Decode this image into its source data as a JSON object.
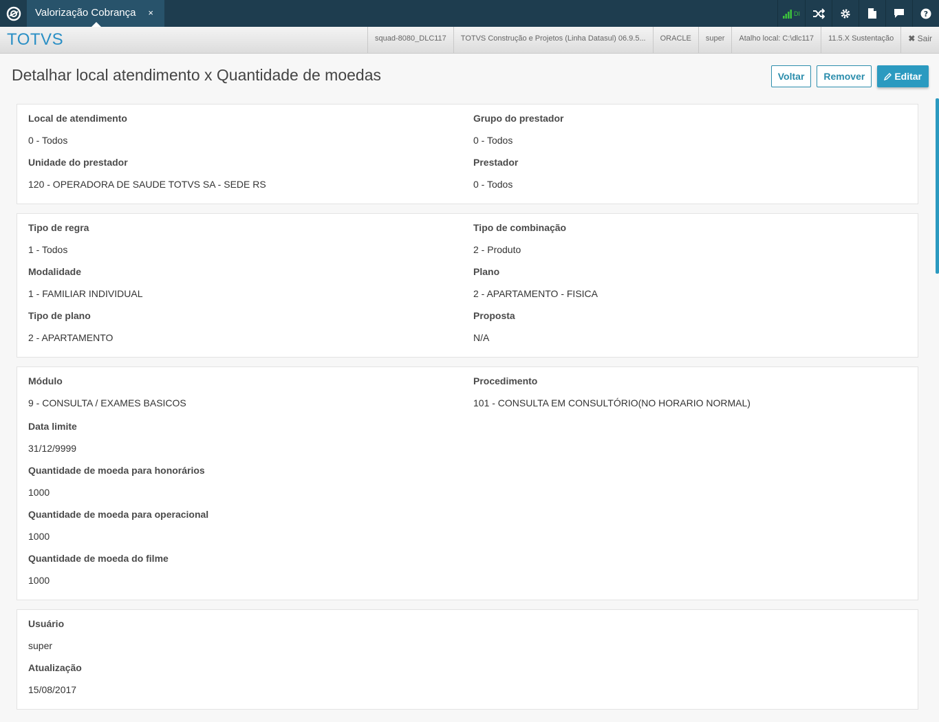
{
  "topbar": {
    "tab_label": "Valorização Cobrança",
    "tab_close": "×",
    "signal_text": "DI"
  },
  "brandbar": {
    "brand": "TOTVS",
    "info": [
      "squad-8080_DLC117",
      "TOTVS Construção e Projetos (Linha Datasul) 06.9.5...",
      "ORACLE",
      "super",
      "Atalho local: C:\\dlc117",
      "11.5.X Sustentação"
    ],
    "exit_label": "Sair"
  },
  "page": {
    "title": "Detalhar local atendimento x Quantidade de moedas",
    "btn_voltar": "Voltar",
    "btn_remover": "Remover",
    "btn_editar": "Editar"
  },
  "card1": {
    "local_label": "Local de atendimento",
    "local_value": "0 - Todos",
    "grupo_label": "Grupo do prestador",
    "grupo_value": "0 - Todos",
    "unidade_label": "Unidade do prestador",
    "unidade_value": "120 - OPERADORA DE SAUDE TOTVS SA - SEDE RS",
    "prestador_label": "Prestador",
    "prestador_value": "0 - Todos"
  },
  "card2": {
    "tipo_regra_label": "Tipo de regra",
    "tipo_regra_value": "1 - Todos",
    "tipo_comb_label": "Tipo de combinação",
    "tipo_comb_value": "2 - Produto",
    "modalidade_label": "Modalidade",
    "modalidade_value": "1 - FAMILIAR INDIVIDUAL",
    "plano_label": "Plano",
    "plano_value": "2 - APARTAMENTO - FISICA",
    "tipo_plano_label": "Tipo de plano",
    "tipo_plano_value": "2 - APARTAMENTO",
    "proposta_label": "Proposta",
    "proposta_value": "N/A"
  },
  "card3": {
    "modulo_label": "Módulo",
    "modulo_value": "9 - CONSULTA / EXAMES BASICOS",
    "procedimento_label": "Procedimento",
    "procedimento_value": "101 - CONSULTA EM CONSULTÓRIO(NO HORARIO NORMAL)",
    "data_limite_label": "Data limite",
    "data_limite_value": "31/12/9999",
    "qtd_honorarios_label": "Quantidade de moeda para honorários",
    "qtd_honorarios_value": "1000",
    "qtd_operacional_label": "Quantidade de moeda para operacional",
    "qtd_operacional_value": "1000",
    "qtd_filme_label": "Quantidade de moeda do filme",
    "qtd_filme_value": "1000"
  },
  "card4": {
    "usuario_label": "Usuário",
    "usuario_value": "super",
    "atualizacao_label": "Atualização",
    "atualizacao_value": "15/08/2017"
  },
  "colors": {
    "topbar": "#1e3d4f",
    "tab": "#28536b",
    "brand": "#2a8fc5",
    "accent": "#2b9ac0",
    "signal": "#3cc23c"
  },
  "icons": [
    "totvs-logo-icon",
    "signal-icon",
    "shuffle-icon",
    "gear-icon",
    "document-icon",
    "chat-icon",
    "help-icon",
    "close-icon",
    "pencil-icon"
  ]
}
